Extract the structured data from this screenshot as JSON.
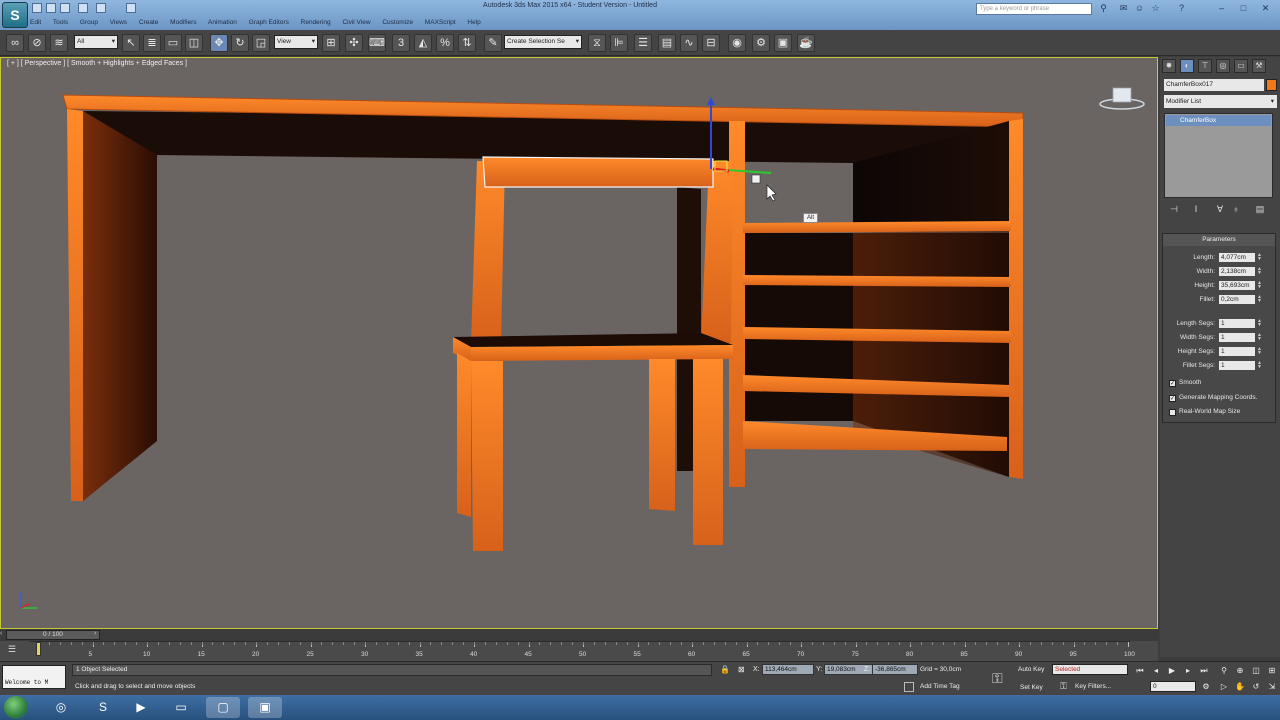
{
  "titlebar": {
    "title": "Autodesk 3ds Max 2015 x64 - Student Version - Untitled",
    "search_placeholder": "Type a keyword or phrase",
    "menus": [
      "Edit",
      "Tools",
      "Group",
      "Views",
      "Create",
      "Modifiers",
      "Animation",
      "Graph Editors",
      "Rendering",
      "Civil View",
      "Customize",
      "MAXScript",
      "Help"
    ]
  },
  "toolbar": {
    "selection_filter": "All",
    "ref_coord": "View",
    "named_selection": "Create Selection Se"
  },
  "viewport": {
    "label": "[ + ] [ Perspective ] [ Smooth + Highlights + Edged Faces ]",
    "alt_badge": "Alt"
  },
  "command_panel": {
    "object_name": "ChamferBox017",
    "object_color": "#f0781a",
    "modifier_list": "Modifier List",
    "stack_item": "ChamferBox",
    "rollout_title": "Parameters",
    "params": [
      {
        "label": "Length:",
        "value": "4,077cm"
      },
      {
        "label": "Width:",
        "value": "2,138cm"
      },
      {
        "label": "Height:",
        "value": "35,693cm"
      },
      {
        "label": "Fillet:",
        "value": "0,2cm"
      }
    ],
    "segs": [
      {
        "label": "Length Segs:",
        "value": "1"
      },
      {
        "label": "Width Segs:",
        "value": "1"
      },
      {
        "label": "Height Segs:",
        "value": "1"
      },
      {
        "label": "Fillet Segs:",
        "value": "1"
      }
    ],
    "checks": [
      {
        "label": "Smooth",
        "checked": true
      },
      {
        "label": "Generate Mapping Coords.",
        "checked": true
      },
      {
        "label": "Real-World Map Size",
        "checked": false
      }
    ]
  },
  "timeline": {
    "frame_counter": "0 / 100",
    "ticks": [
      "5",
      "10",
      "15",
      "20",
      "25",
      "30",
      "35",
      "40",
      "45",
      "50",
      "55",
      "60",
      "65",
      "70",
      "75",
      "80",
      "85",
      "90",
      "95",
      "100"
    ]
  },
  "status": {
    "maxscript": "Welcome to M",
    "selection": "1 Object Selected",
    "prompt": "Click and drag to select and move objects",
    "x": "113,464cm",
    "y": "19,083cm",
    "z": "-36,865cm",
    "grid": "Grid = 30,0cm",
    "add_time_tag": "Add Time Tag",
    "auto_key": "Auto Key",
    "set_key": "Set Key",
    "selected_dropdown": "Selected",
    "key_filters": "Key Filters...",
    "frame_value": "0"
  },
  "icons": {
    "accent": "#f0781a",
    "selection_blue": "#6c8fc0"
  }
}
